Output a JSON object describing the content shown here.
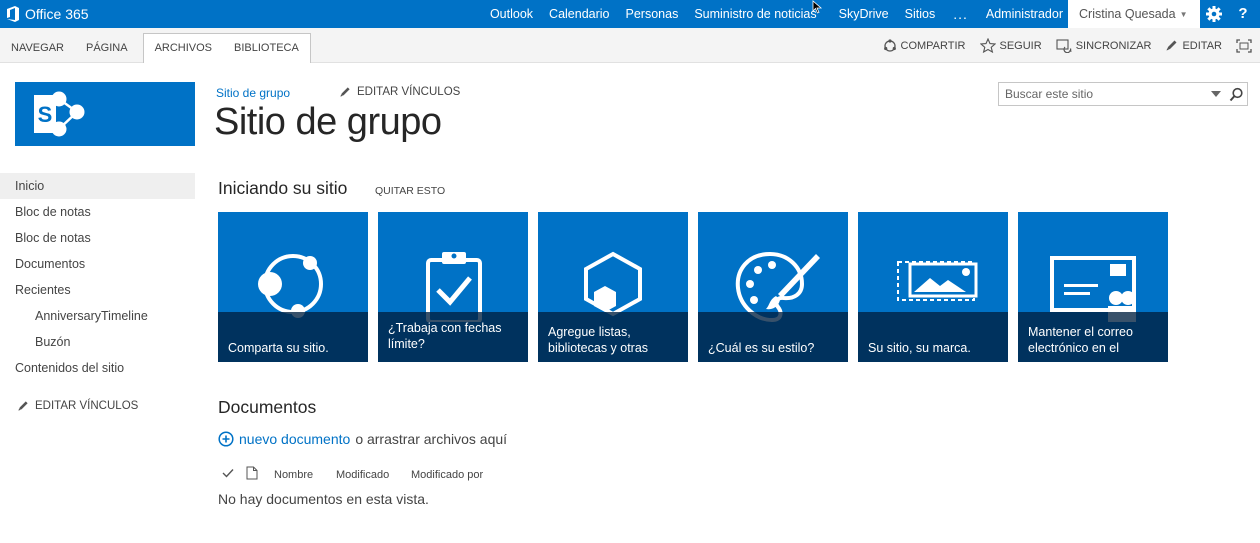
{
  "suitebar": {
    "brand": "Office 365",
    "nav": [
      "Outlook",
      "Calendario",
      "Personas",
      "Suministro de noticias",
      "SkyDrive",
      "Sitios",
      "...",
      "Administrador"
    ],
    "user": "Cristina Quesada",
    "help": "?",
    "colors": {
      "suite_blue": "#0072c6"
    }
  },
  "ribbon": {
    "tabs": [
      "NAVEGAR",
      "PÁGINA"
    ],
    "group_tabs": [
      "ARCHIVOS",
      "BIBLIOTECA"
    ],
    "actions": {
      "share": "COMPARTIR",
      "follow": "SEGUIR",
      "sync": "SINCRONIZAR",
      "edit": "EDITAR"
    }
  },
  "quicklaunch": {
    "items": [
      {
        "label": "Inicio"
      },
      {
        "label": "Bloc de notas"
      },
      {
        "label": "Bloc de notas"
      },
      {
        "label": "Documentos"
      },
      {
        "label": "Recientes"
      },
      {
        "label": "AnniversaryTimeline"
      },
      {
        "label": "Buzón"
      },
      {
        "label": "Contenidos del sitio"
      }
    ],
    "edit_links": "EDITAR VÍNCULOS"
  },
  "header": {
    "breadcrumb": "Sitio de grupo",
    "edit_links": "EDITAR VÍNCULOS",
    "title": "Sitio de grupo",
    "search_placeholder": "Buscar este sitio"
  },
  "getting_started": {
    "title": "Iniciando su sitio",
    "remove": "QUITAR ESTO",
    "tiles": [
      {
        "label": "Comparta su sitio.",
        "icon": "share-icon"
      },
      {
        "label": "¿Trabaja con fechas límite?",
        "icon": "clipboard-check-icon"
      },
      {
        "label": "Agregue listas, bibliotecas y otras",
        "icon": "apps-hexagon-icon"
      },
      {
        "label": "¿Cuál es su estilo?",
        "icon": "palette-icon"
      },
      {
        "label": "Su sitio, su marca.",
        "icon": "brand-image-icon"
      },
      {
        "label": "Mantener el correo electrónico en el",
        "icon": "email-card-icon"
      }
    ]
  },
  "documents": {
    "title": "Documentos",
    "new_link": "nuevo documento",
    "or_drag": "o arrastrar archivos aquí",
    "columns": [
      "Nombre",
      "Modificado",
      "Modificado por"
    ],
    "empty": "No hay documentos en esta vista."
  }
}
